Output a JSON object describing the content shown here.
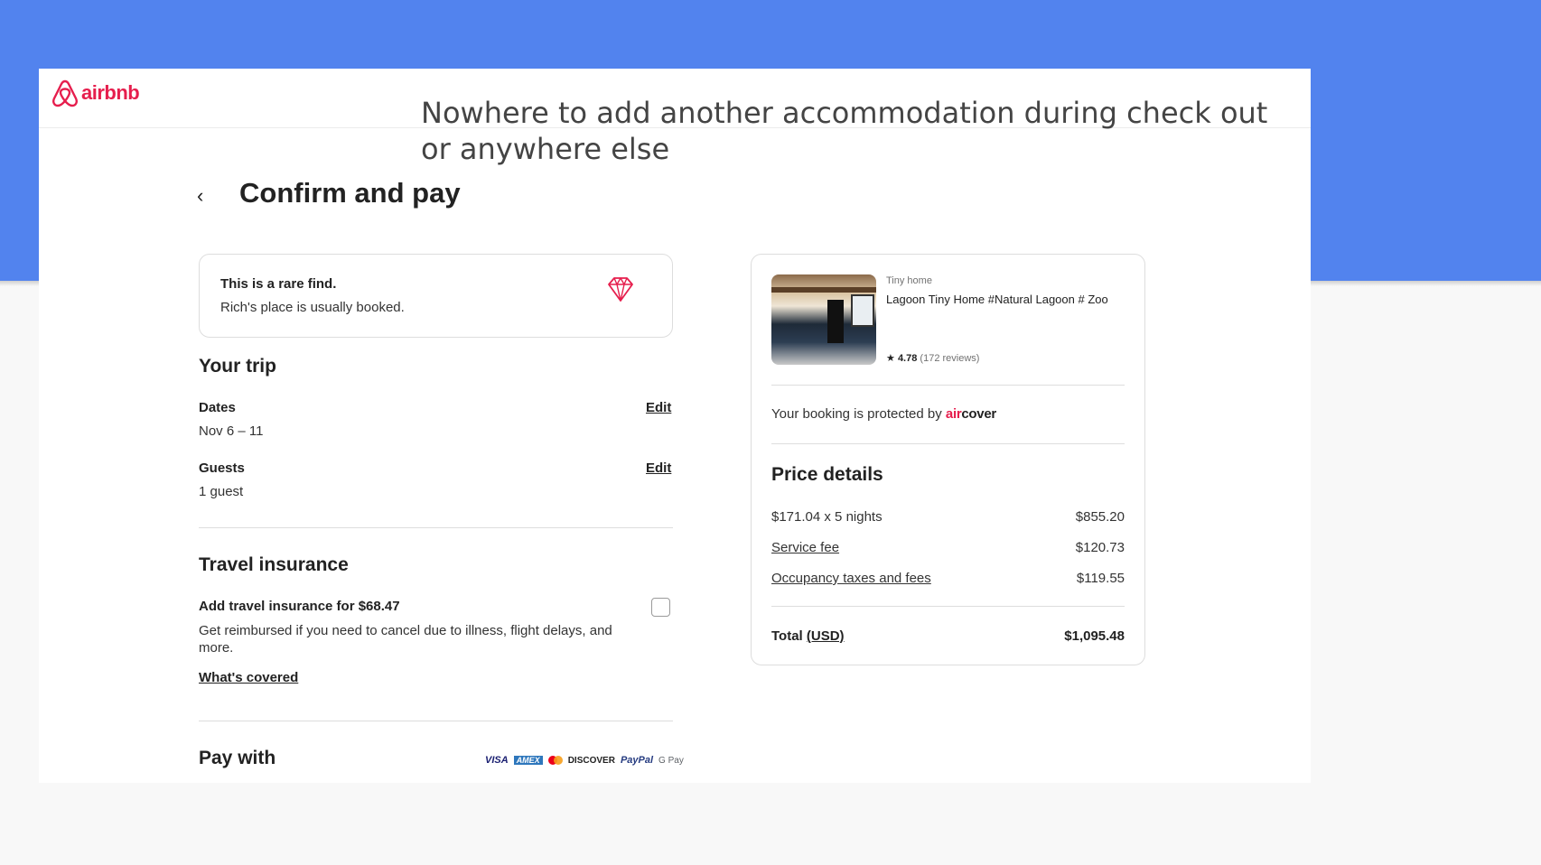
{
  "slide": {
    "annotation": "Nowhere to add another accommodation during check out or anywhere else",
    "band_color": "#5283ee"
  },
  "header": {
    "logo_text": "airbnb",
    "logo_icon": "airbnb-belo-icon",
    "brand_color": "#e61e4d"
  },
  "page": {
    "back_icon": "chevron-left-icon",
    "title": "Confirm and pay"
  },
  "rare_find": {
    "title": "This is a rare find.",
    "subtitle": "Rich's place is usually booked.",
    "icon": "diamond-icon"
  },
  "trip": {
    "heading": "Your trip",
    "dates_label": "Dates",
    "dates_value": "Nov 6 – 11",
    "guests_label": "Guests",
    "guests_value": "1 guest",
    "edit_label": "Edit"
  },
  "insurance": {
    "heading": "Travel insurance",
    "title": "Add travel insurance for $68.47",
    "description": "Get reimbursed if you need to cancel due to illness, flight delays, and more.",
    "link": "What's covered",
    "checked": false
  },
  "payment": {
    "heading": "Pay with",
    "methods": [
      "VISA",
      "AMEX",
      "DISCOVER",
      "PayPal",
      "G Pay"
    ]
  },
  "listing": {
    "type": "Tiny home",
    "name": "Lagoon Tiny Home #Natural Lagoon # Zoo",
    "rating": "4.78",
    "reviews": "(172 reviews)"
  },
  "protection": {
    "text": "Your booking is protected by",
    "brand_air": "air",
    "brand_cover": "cover"
  },
  "price_details": {
    "heading": "Price details",
    "rows": [
      {
        "label": "$171.04 x 5 nights",
        "value": "$855.20"
      },
      {
        "label": "Service fee",
        "value": "$120.73"
      },
      {
        "label": "Occupancy taxes and fees",
        "value": "$119.55"
      }
    ],
    "total_label": "Total",
    "currency_label": "(USD)",
    "total_value": "$1,095.48"
  }
}
